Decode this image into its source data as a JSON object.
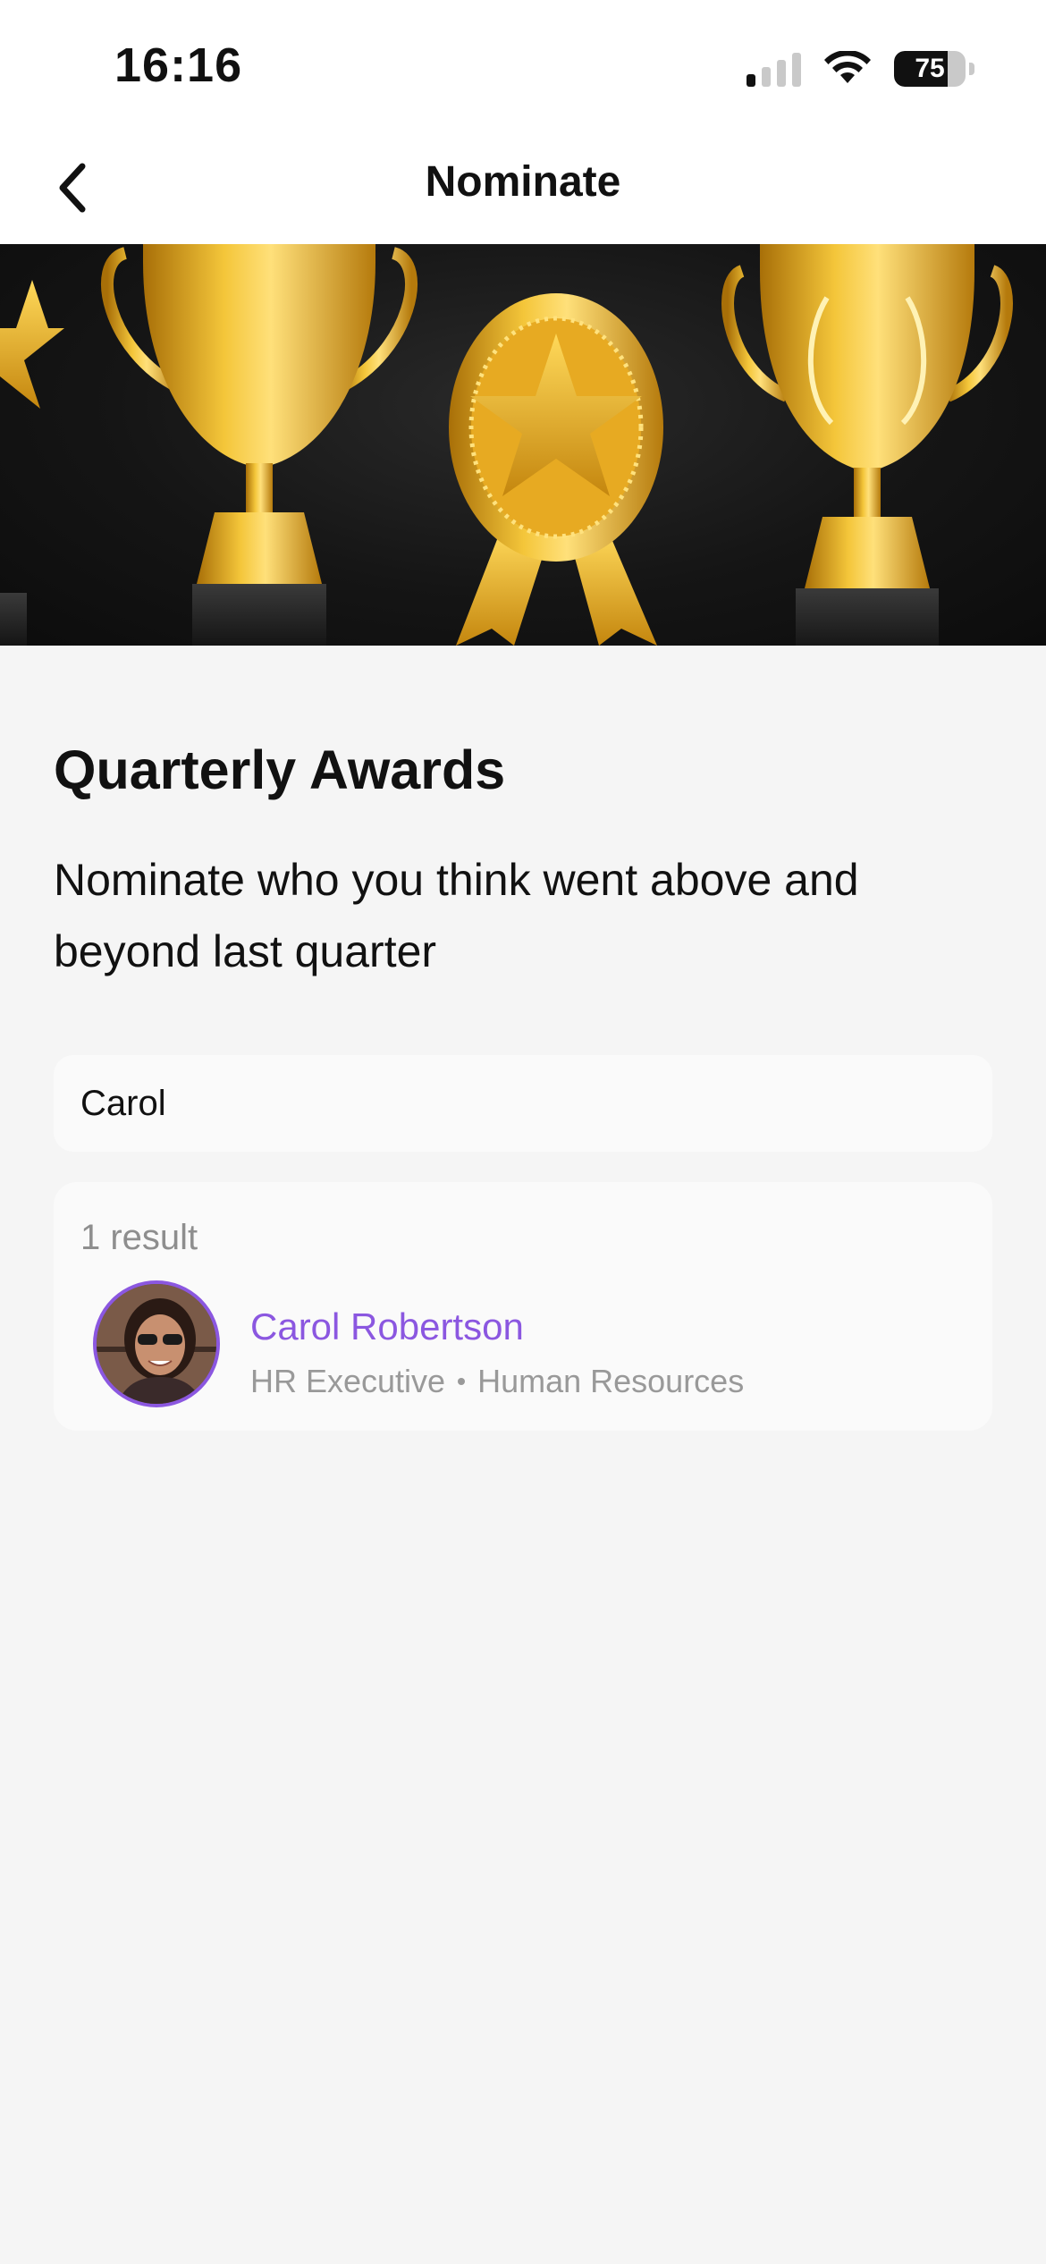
{
  "status_bar": {
    "time": "16:16",
    "battery_level": 75,
    "battery_text": "75",
    "signal_bars_active": 1,
    "signal_bars_total": 4
  },
  "nav": {
    "title": "Nominate",
    "back_icon": "chevron-left-icon"
  },
  "banner": {
    "description_icons": [
      "star-icon",
      "trophy-icon",
      "medal-icon",
      "trophy-laurel-icon"
    ],
    "accent_gold": "#e0a81c"
  },
  "main": {
    "title": "Quarterly Awards",
    "subtitle": "Nominate who you think went above and beyond last quarter",
    "search": {
      "value": "Carol",
      "placeholder": ""
    },
    "results": {
      "count_label": "1 result",
      "items": [
        {
          "name": "Carol Robertson",
          "role": "HR Executive",
          "department": "Human Resources"
        }
      ]
    }
  },
  "colors": {
    "accent": "#8b57e0",
    "background": "#f5f5f5",
    "muted_text": "#999999"
  }
}
